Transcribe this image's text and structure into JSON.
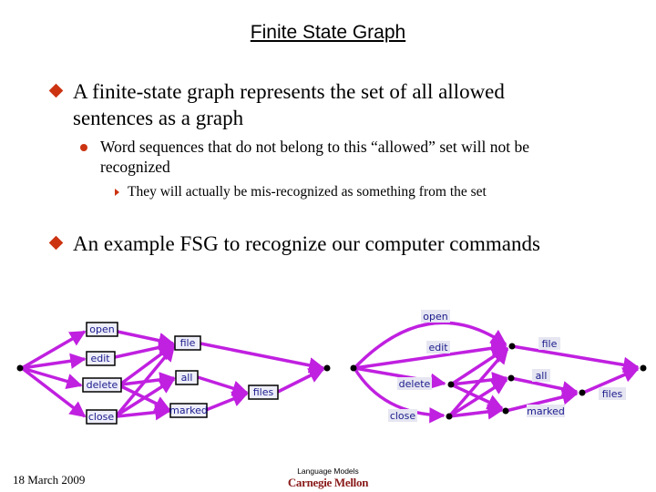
{
  "slide": {
    "title": "Finite State Graph",
    "bullets": [
      {
        "level": 1,
        "text_lines": [
          "A finite-state graph represents the set of all allowed",
          "sentences as a graph"
        ]
      },
      {
        "level": 2,
        "text_lines": [
          "Word sequences that do not belong to this “allowed” set will not be",
          "recognized"
        ]
      },
      {
        "level": 3,
        "text_lines": [
          "They will actually be mis-recognized as something from the set"
        ]
      },
      {
        "level": 1,
        "text_lines": [
          "An example FSG to recognize our computer commands"
        ]
      }
    ],
    "accent_color": "#cc3311",
    "edge_color": "#c020e0",
    "footer": {
      "date": "18  March 2009",
      "course": "Language Models",
      "institution": "Carnegie Mellon"
    }
  },
  "left_graph": {
    "description": "Word-node graph",
    "nodes": [
      "open",
      "edit",
      "delete",
      "close",
      "file",
      "all",
      "marked",
      "files"
    ],
    "edges": [
      [
        "start",
        "open"
      ],
      [
        "start",
        "edit"
      ],
      [
        "start",
        "delete"
      ],
      [
        "start",
        "close"
      ],
      [
        "open",
        "file"
      ],
      [
        "edit",
        "file"
      ],
      [
        "delete",
        "file"
      ],
      [
        "close",
        "file"
      ],
      [
        "delete",
        "all"
      ],
      [
        "close",
        "all"
      ],
      [
        "delete",
        "marked"
      ],
      [
        "close",
        "marked"
      ],
      [
        "all",
        "files"
      ],
      [
        "marked",
        "files"
      ],
      [
        "file",
        "end"
      ],
      [
        "files",
        "end"
      ]
    ]
  },
  "right_graph": {
    "description": "Word-labeled-edge graph",
    "edge_labels": [
      "open",
      "edit",
      "delete",
      "close",
      "file",
      "all",
      "marked",
      "files"
    ]
  }
}
